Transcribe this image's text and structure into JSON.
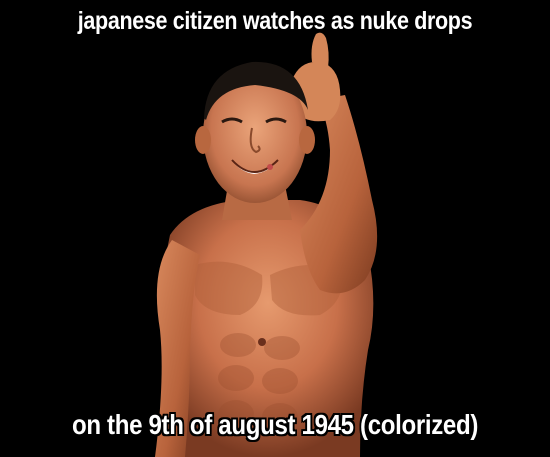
{
  "meme": {
    "top_text": "japanese citizen watches as nuke drops",
    "bottom_text": "on the 9th of august 1945 (colorized)"
  },
  "colors": {
    "background": "#000000",
    "caption_text": "#ffffff",
    "caption_outline": "#000000",
    "skin_tone": "#c8704a"
  }
}
